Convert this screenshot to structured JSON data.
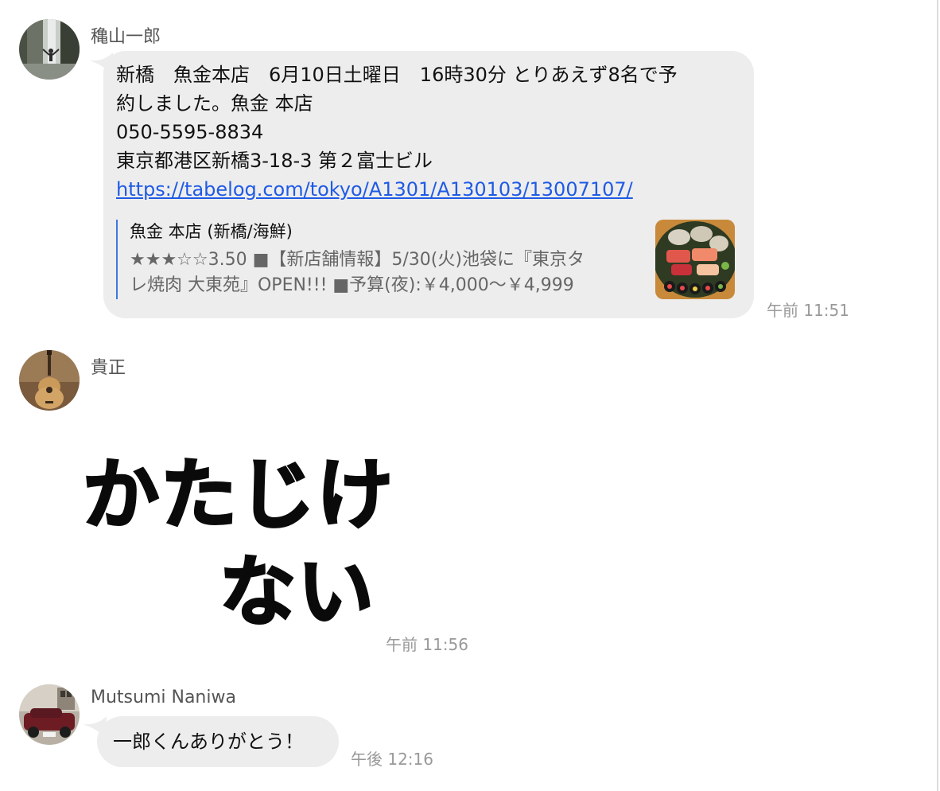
{
  "messages": [
    {
      "sender": "穐山一郎",
      "lines": [
        "新橋　魚金本店　6月10日土曜日　16時30分 とりあえず8名で予",
        "約しました。魚金 本店",
        "050-5595-8834",
        "東京都港区新橋3-18-3 第２富士ビル"
      ],
      "link": "https://tabelog.com/tokyo/A1301/A130103/13007107/",
      "preview": {
        "title": "魚金 本店 (新橋/海鮮)",
        "desc_line1": "★★★☆☆3.50 ■【新店舗情報】5/30(火)池袋に『東京タ",
        "desc_line2": "レ焼肉 大東苑』OPEN!!! ■予算(夜):￥4,000～￥4,999"
      },
      "time": "午前 11:51"
    },
    {
      "sender": "貴正",
      "sticker": {
        "line1": "かたじけ",
        "line2": "ない"
      },
      "time": "午前 11:56"
    },
    {
      "sender": "Mutsumi Naniwa",
      "text": "一郎くんありがとう！",
      "time": "午後 12:16"
    }
  ],
  "colors": {
    "bubble": "#ededed",
    "link": "#1e5ae6",
    "timestamp": "#999999",
    "preview_bar": "#3a78e0"
  },
  "icons": [
    "avatar-waterfall",
    "avatar-guitar",
    "avatar-car",
    "sushi-thumbnail"
  ]
}
